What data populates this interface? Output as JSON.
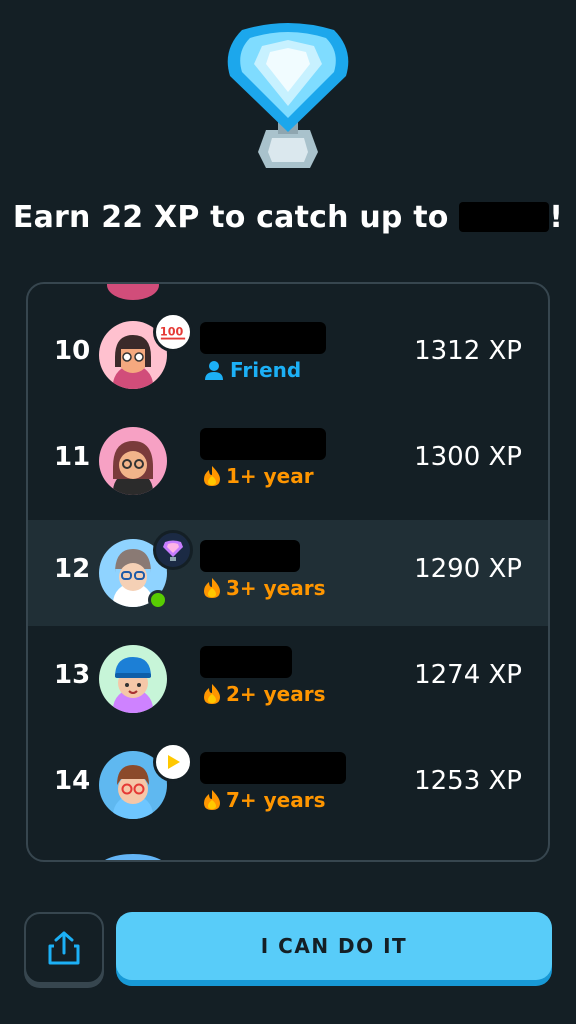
{
  "header": {
    "headline_prefix": "Earn 22 XP to catch up to",
    "headline_suffix": "!"
  },
  "leaderboard": {
    "rows": [
      {
        "rank": "10",
        "sub_text": "Friend",
        "sub_type": "friend",
        "xp": "1312 XP",
        "badge": "hundred-badge-icon"
      },
      {
        "rank": "11",
        "sub_text": "1+ year",
        "sub_type": "streak",
        "xp": "1300 XP",
        "badge": ""
      },
      {
        "rank": "12",
        "sub_text": "3+ years",
        "sub_type": "streak",
        "xp": "1290 XP",
        "badge": "diamond-league-badge-icon",
        "highlighted": true,
        "online": true
      },
      {
        "rank": "13",
        "sub_text": "2+ years",
        "sub_type": "streak",
        "xp": "1274 XP",
        "badge": ""
      },
      {
        "rank": "14",
        "sub_text": "7+ years",
        "sub_type": "streak",
        "xp": "1253 XP",
        "badge": "play-badge-icon"
      }
    ]
  },
  "footer": {
    "share_icon": "share-icon",
    "main_button_label": "I CAN DO IT"
  },
  "colors": {
    "background": "#141f25",
    "highlight_row": "#202f36",
    "friend_blue": "#1cb0f6",
    "streak_orange": "#ff9600",
    "button_blue": "#58ccf9"
  }
}
